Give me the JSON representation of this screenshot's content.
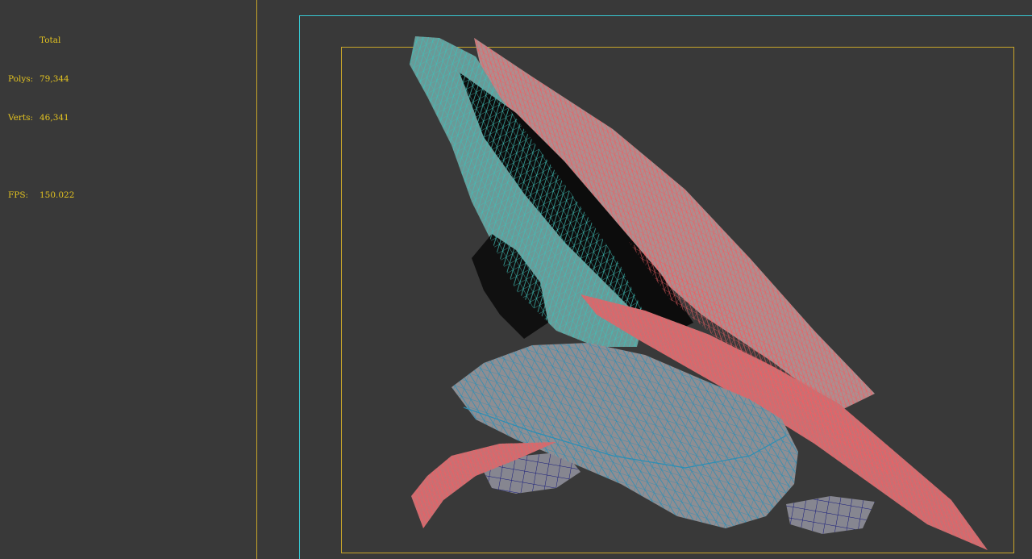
{
  "hud": {
    "header": "Total",
    "polys_label": "Polys:",
    "polys_value": "79,344",
    "verts_label": "Verts:",
    "verts_value": "46,341",
    "fps_label": "FPS:",
    "fps_value": "150.022"
  },
  "colors": {
    "background": "#393939",
    "hud_text": "#e3c320",
    "gate_yellow": "#c9a62a",
    "gate_cyan": "#37c9d3",
    "wire_cyan": "#3fbfb7",
    "wire_blue": "#2a8fb6",
    "wire_red": "#ef5e63",
    "wire_navy": "#14187a",
    "shade_grey": "#8e8e93"
  }
}
